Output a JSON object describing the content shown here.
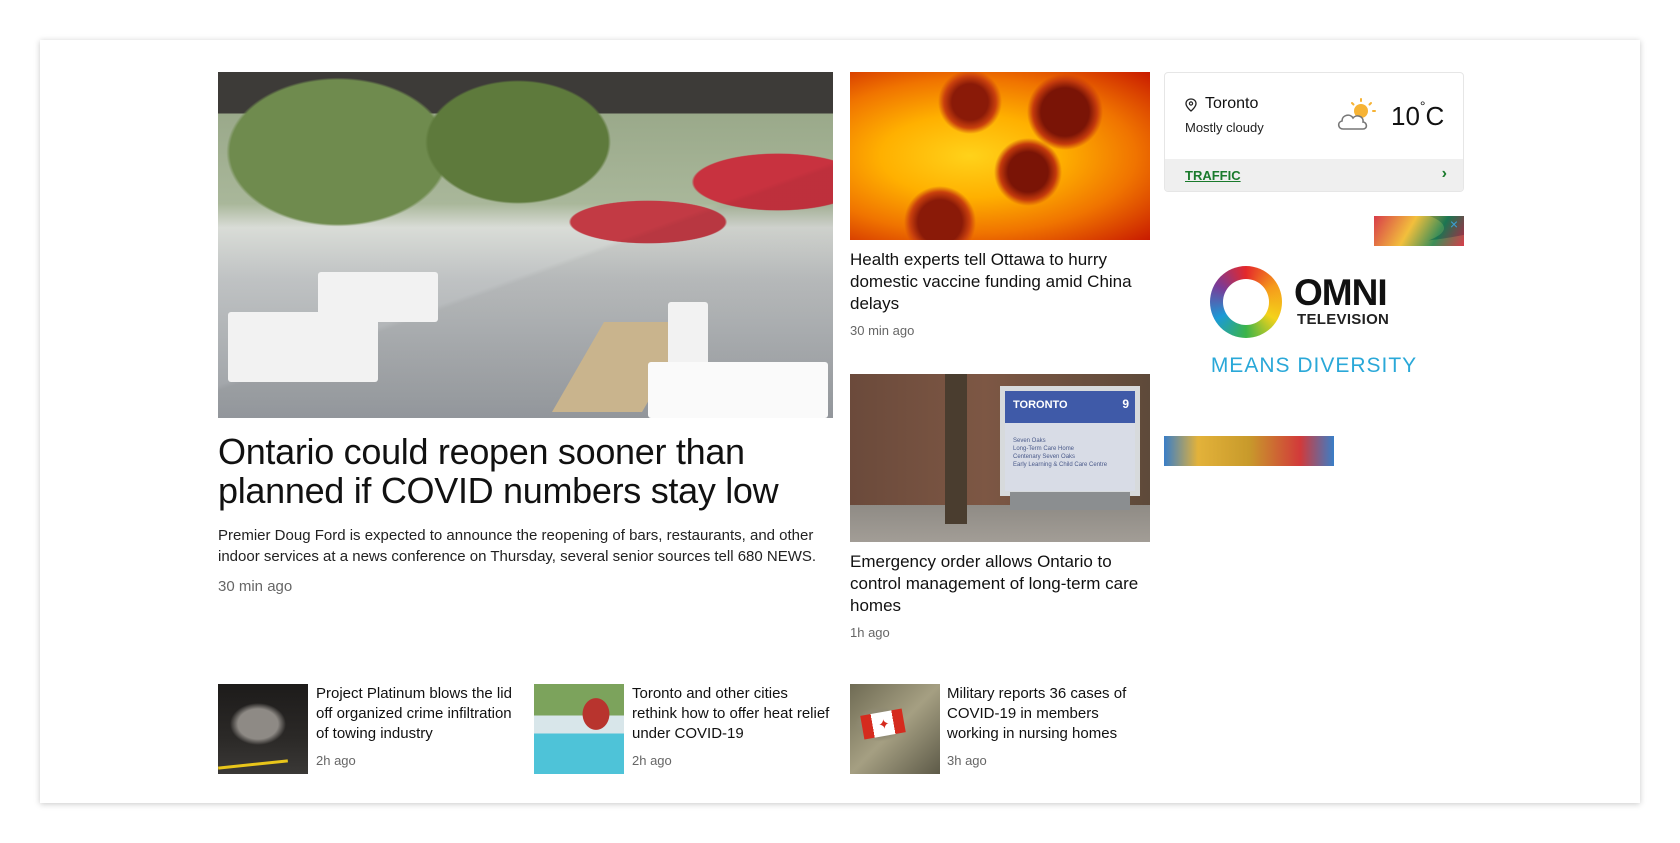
{
  "lead": {
    "headline": "Ontario could reopen sooner than planned if COVID numbers stay low",
    "summary": "Premier Doug Ford is expected to announce the reopening of bars, restaurants, and other indoor services at a news conference on Thursday, several senior sources tell 680 NEWS.",
    "time": "30 min ago"
  },
  "middle": [
    {
      "headline": "Health experts tell Ottawa to hurry domestic vaccine funding amid China delays",
      "time": "30 min ago"
    },
    {
      "headline": "Emergency order allows Ontario to control management of long-term care homes",
      "time": "1h ago"
    }
  ],
  "sign_image_text": {
    "title": "TORONTO",
    "number": "9",
    "lines": [
      "Seven Oaks",
      "Long-Term Care Home",
      "Centenary Seven Oaks",
      "Early Learning & Child Care Centre"
    ]
  },
  "small_stories": [
    {
      "headline": "Project Platinum blows the lid off organized crime infiltration of towing industry",
      "time": "2h ago",
      "thumb": "wreck"
    },
    {
      "headline": "Toronto and other cities rethink how to offer heat relief under COVID-19",
      "time": "2h ago",
      "thumb": "pool"
    },
    {
      "headline": "Military reports 36 cases of COVID-19 in members working in nursing homes",
      "time": "3h ago",
      "thumb": "military"
    }
  ],
  "weather": {
    "city": "Toronto",
    "condition": "Mostly cloudy",
    "temp": "10",
    "unit": "C",
    "degree": "°",
    "icon": "partly-cloudy-icon",
    "traffic_label": "TRAFFIC",
    "chevron": "›",
    "accent": "#1a7a2c"
  },
  "ad": {
    "brand": "OMNI",
    "sub": "TELEVISION",
    "tagline": "MEANS DIVERSITY",
    "close": "×"
  }
}
